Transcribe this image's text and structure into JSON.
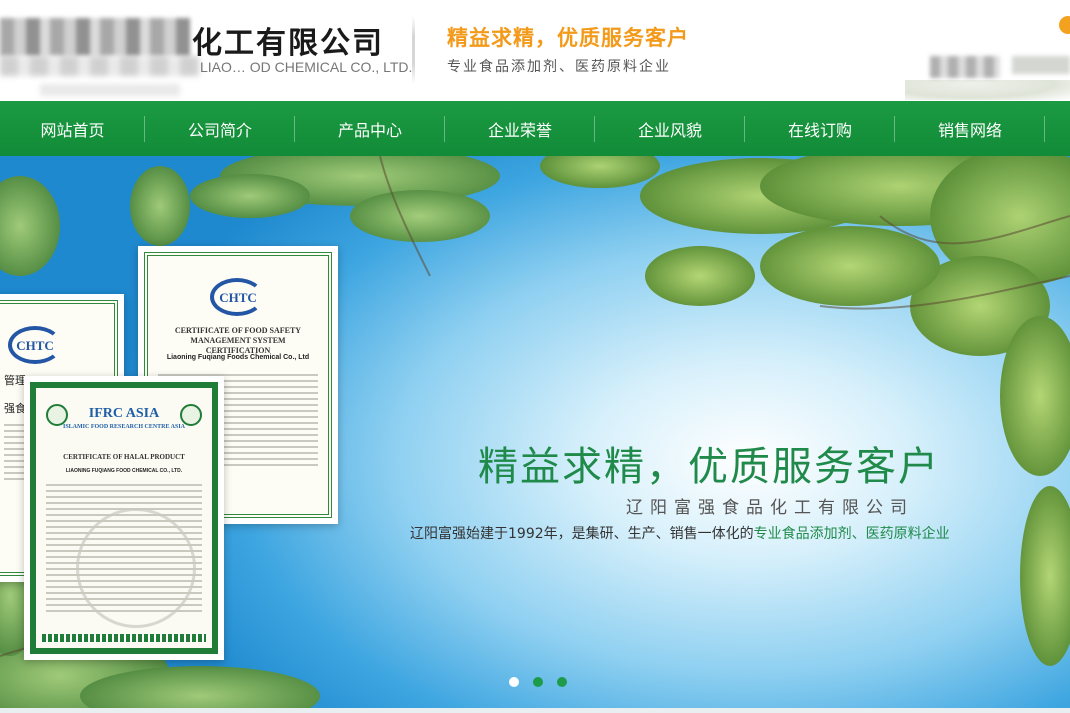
{
  "header": {
    "company_cn": "化工有限公司",
    "company_en": "LIAO… OD CHEMICAL CO., LTD.",
    "slogan": "精益求精，优质服务客户",
    "subslogan": "专业食品添加剂、医药原料企业"
  },
  "nav": {
    "items": [
      {
        "label": "网站首页"
      },
      {
        "label": "公司简介"
      },
      {
        "label": "产品中心"
      },
      {
        "label": "企业荣誉"
      },
      {
        "label": "企业风貌"
      },
      {
        "label": "在线订购"
      },
      {
        "label": "销售网络"
      }
    ]
  },
  "banner": {
    "title": "精益求精，优质服务客户",
    "company": "辽阳富强食品化工有限公司",
    "desc_prefix": "辽阳富强始建于1992年，是集研、生产、销售一体化的",
    "desc_highlight": "专业食品添加剂、医药原料企业",
    "certificates": {
      "cert1": {
        "logo": "CHTC",
        "title": "CERTIFICATE OF FOOD SAFETY MANAGEMENT SYSTEM CERTIFICATION",
        "company": "Liaoning Fuqiang Foods Chemical Co., Ltd"
      },
      "cert2": {
        "logo": "CHTC",
        "side_text_1": "管理",
        "side_text_2": "强食品"
      },
      "cert3": {
        "logo": "IFRC ASIA",
        "subtitle": "ISLAMIC FOOD RESEARCH CENTRE ASIA",
        "heading": "CERTIFICATE OF HALAL PRODUCT",
        "company": "LIAONING FUQIANG FOOD CHEMICAL CO., LTD."
      }
    },
    "slide_count": 3,
    "active_slide": 1
  },
  "colors": {
    "nav_green": "#118b37",
    "slogan_orange": "#f39a1b",
    "banner_text_green": "#1f8a4a"
  },
  "icons": {
    "phone": "phone-icon"
  }
}
